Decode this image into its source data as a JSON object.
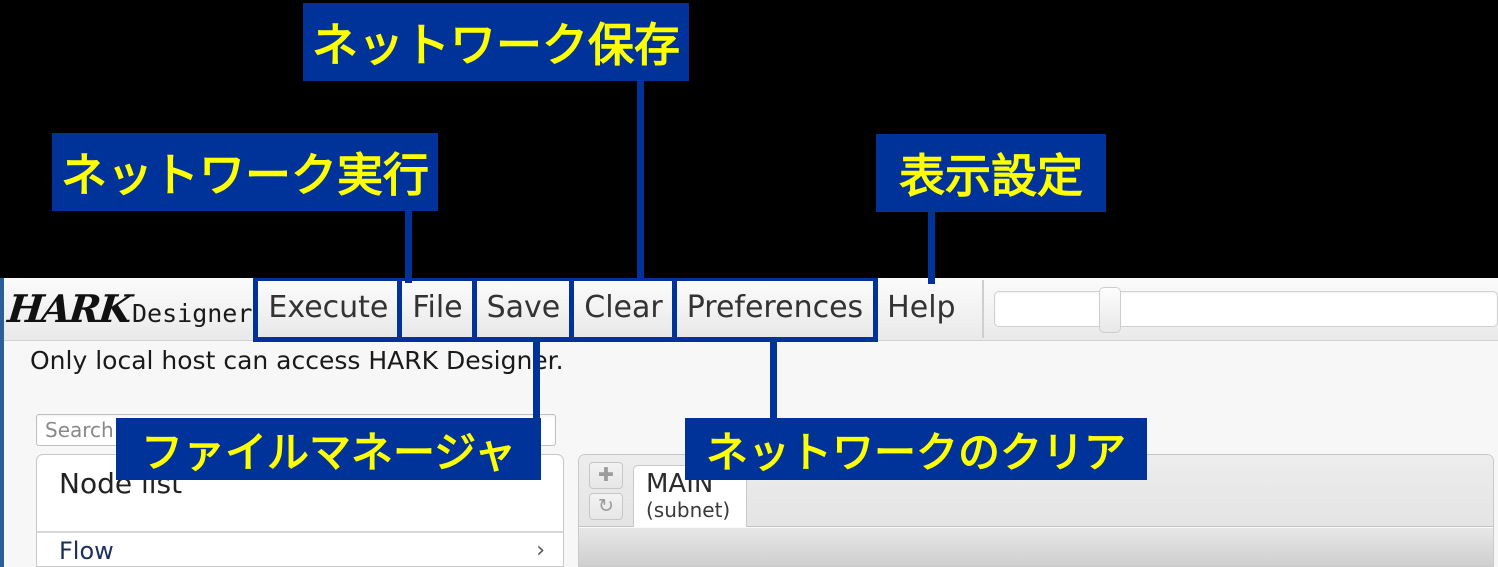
{
  "app": {
    "brand_hark": "HARK",
    "brand_designer": "Designer",
    "notice": "Only local host can access HARK Designer."
  },
  "menubar": {
    "items": [
      {
        "label": "Execute",
        "highlighted": true
      },
      {
        "label": "File",
        "highlighted": true
      },
      {
        "label": "Save",
        "highlighted": true
      },
      {
        "label": "Clear",
        "highlighted": true
      },
      {
        "label": "Preferences",
        "highlighted": true
      },
      {
        "label": "Help",
        "highlighted": false
      }
    ],
    "slider_value": ""
  },
  "left_panel": {
    "search_placeholder": "Search",
    "search_value": "Search",
    "node_list_title": "Node list",
    "rows": [
      {
        "label": "Flow",
        "chevron": "›"
      }
    ]
  },
  "canvas": {
    "add_tab_icon": "✚",
    "reload_tab_icon": "↻",
    "tabs": [
      {
        "name": "MAIN",
        "kind": "(subnet)"
      }
    ]
  },
  "annotations": {
    "colors": {
      "box_bg": "#00339a",
      "text": "#ffff00"
    },
    "items": [
      {
        "id": "save-network",
        "label": "ネットワーク保存"
      },
      {
        "id": "execute-network",
        "label": "ネットワーク実行"
      },
      {
        "id": "display-settings",
        "label": "表示設定"
      },
      {
        "id": "file-manager",
        "label": "ファイルマネージャ"
      },
      {
        "id": "clear-network",
        "label": "ネットワークのクリア"
      }
    ]
  }
}
